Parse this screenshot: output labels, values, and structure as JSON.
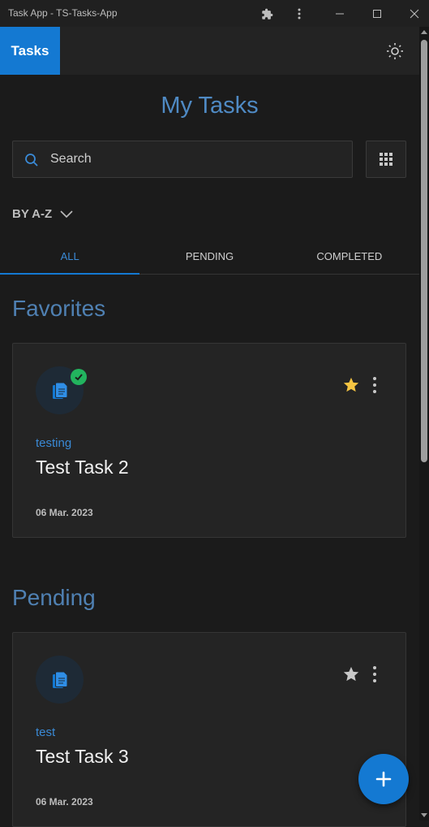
{
  "window": {
    "title": "Task App - TS-Tasks-App"
  },
  "appbar": {
    "brand": "Tasks"
  },
  "page": {
    "title": "My Tasks"
  },
  "search": {
    "placeholder": "Search"
  },
  "sort": {
    "label": "BY A-Z"
  },
  "tabs": [
    {
      "label": "ALL",
      "active": true
    },
    {
      "label": "PENDING",
      "active": false
    },
    {
      "label": "COMPLETED",
      "active": false
    }
  ],
  "sections": {
    "favorites": {
      "title": "Favorites",
      "task": {
        "category": "testing",
        "name": "Test Task 2",
        "date": "06 Mar. 2023",
        "completed": true,
        "favorite": true
      }
    },
    "pending": {
      "title": "Pending",
      "task": {
        "category": "test",
        "name": "Test Task 3",
        "date": "06 Mar. 2023",
        "completed": false,
        "favorite": false
      }
    }
  },
  "colors": {
    "accent": "#1479d2",
    "favorite_star": "#f5c542",
    "check": "#22b35e"
  }
}
